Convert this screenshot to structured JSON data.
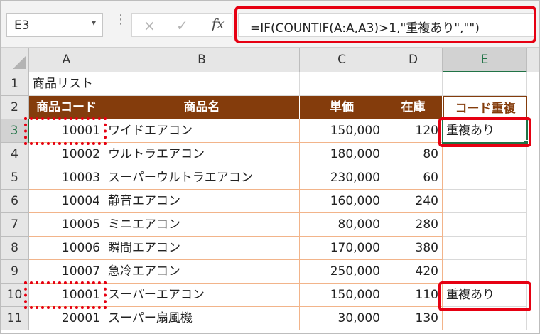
{
  "formula_bar": {
    "name_box": "E3",
    "formula": "=IF(COUNTIF(A:A,A3)>1,\"重複あり\",\"\")",
    "icons": {
      "cancel": "×",
      "enter": "✓",
      "fx": "fx",
      "dropdown": "▾",
      "dots": "⋮"
    }
  },
  "sheet": {
    "columns": [
      "A",
      "B",
      "C",
      "D",
      "E"
    ],
    "row_numbers": [
      "1",
      "2",
      "3",
      "4",
      "5",
      "6",
      "7",
      "8",
      "9",
      "10",
      "11"
    ],
    "title": "商品リスト",
    "headers": {
      "code": "商品コード",
      "name": "商品名",
      "price": "単価",
      "stock": "在庫",
      "dup": "コード重複"
    },
    "rows": [
      {
        "code": "10001",
        "name": "ワイドエアコン",
        "price": "150,000",
        "stock": "120",
        "dup": "重複あり"
      },
      {
        "code": "10002",
        "name": "ウルトラエアコン",
        "price": "180,000",
        "stock": "80",
        "dup": ""
      },
      {
        "code": "10003",
        "name": "スーパーウルトラエアコン",
        "price": "230,000",
        "stock": "60",
        "dup": ""
      },
      {
        "code": "10004",
        "name": "静音エアコン",
        "price": "160,000",
        "stock": "240",
        "dup": ""
      },
      {
        "code": "10005",
        "name": "ミニエアコン",
        "price": "80,000",
        "stock": "280",
        "dup": ""
      },
      {
        "code": "10006",
        "name": "瞬間エアコン",
        "price": "170,000",
        "stock": "380",
        "dup": ""
      },
      {
        "code": "10007",
        "name": "急冷エアコン",
        "price": "250,000",
        "stock": "420",
        "dup": ""
      },
      {
        "code": "10001",
        "name": "スーパーエアコン",
        "price": "150,000",
        "stock": "110",
        "dup": "重複あり"
      },
      {
        "code": "20001",
        "name": "スーパー扇風機",
        "price": "30,000",
        "stock": "130",
        "dup": ""
      }
    ]
  },
  "colors": {
    "header_bg": "#843c0c",
    "highlight": "#e60012",
    "selection": "#217346"
  }
}
